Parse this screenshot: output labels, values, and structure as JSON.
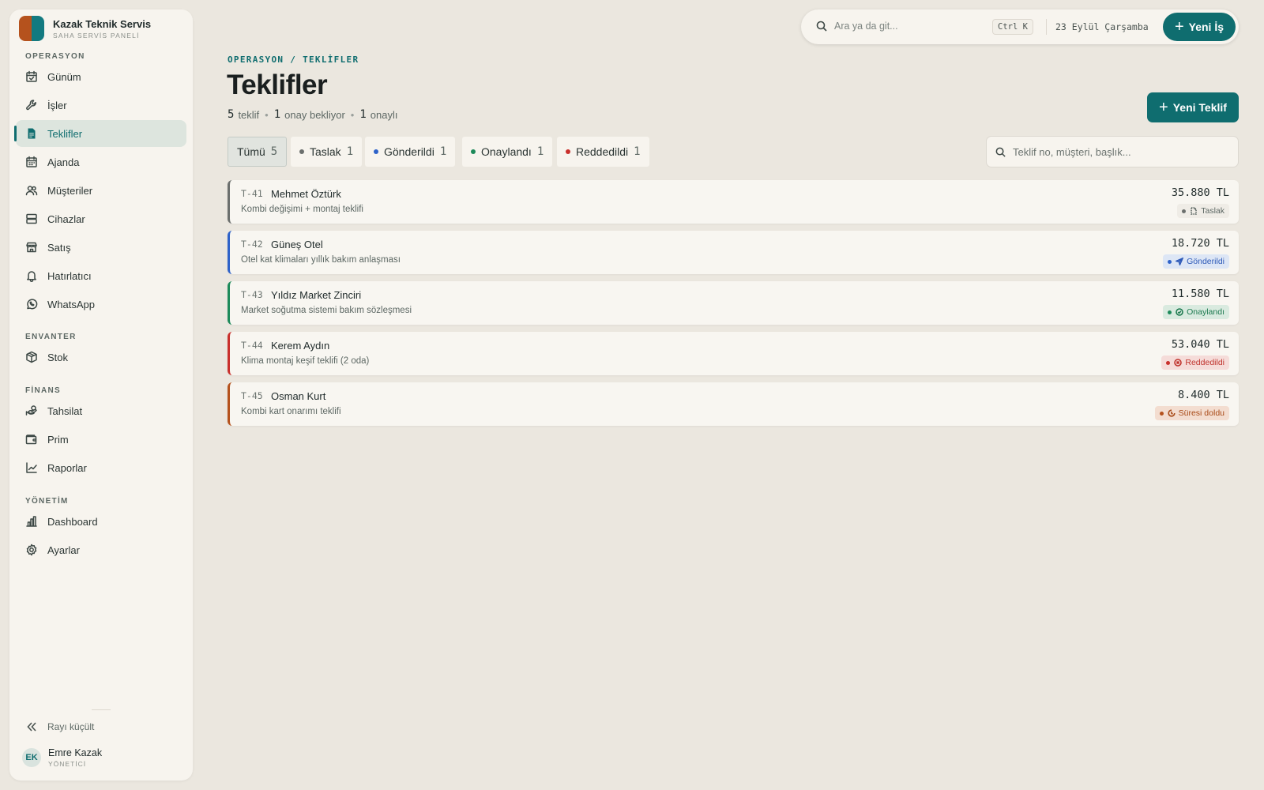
{
  "app": {
    "name": "Kazak Teknik Servis",
    "subtitle": "SAHA SERVİS PANELİ",
    "brand_colors": [
      "#b5521d",
      "#137a80"
    ]
  },
  "sidebar": {
    "sections": [
      {
        "label": "OPERASYON",
        "items": [
          {
            "label": "Günüm",
            "icon": "calendar-check-icon"
          },
          {
            "label": "İşler",
            "icon": "wrench-icon"
          },
          {
            "label": "Teklifler",
            "icon": "document-icon",
            "active": true
          },
          {
            "label": "Ajanda",
            "icon": "calendar-icon"
          },
          {
            "label": "Müşteriler",
            "icon": "users-icon"
          },
          {
            "label": "Cihazlar",
            "icon": "server-icon"
          },
          {
            "label": "Satış",
            "icon": "store-icon"
          },
          {
            "label": "Hatırlatıcı",
            "icon": "bell-icon"
          },
          {
            "label": "WhatsApp",
            "icon": "whatsapp-icon"
          }
        ]
      },
      {
        "label": "ENVANTER",
        "items": [
          {
            "label": "Stok",
            "icon": "box-icon"
          }
        ]
      },
      {
        "label": "FİNANS",
        "items": [
          {
            "label": "Tahsilat",
            "icon": "hand-coins-icon"
          },
          {
            "label": "Prim",
            "icon": "wallet-icon"
          },
          {
            "label": "Raporlar",
            "icon": "chart-line-icon"
          }
        ]
      },
      {
        "label": "YÖNETİM",
        "items": [
          {
            "label": "Dashboard",
            "icon": "bar-chart-icon"
          },
          {
            "label": "Ayarlar",
            "icon": "gear-icon"
          }
        ]
      }
    ],
    "collapse_label": "Rayı küçült",
    "user": {
      "initials": "EK",
      "name": "Emre Kazak",
      "role": "YÖNETİCİ"
    }
  },
  "topbar": {
    "search_placeholder": "Ara ya da git...",
    "shortcut": "Ctrl K",
    "date": "23 Eylül Çarşamba",
    "new_job_label": "Yeni İş"
  },
  "page": {
    "breadcrumb": "OPERASYON / TEKLİFLER",
    "title": "Teklifler",
    "summary": [
      {
        "num": "5",
        "label": "teklif"
      },
      {
        "num": "1",
        "label": "onay bekliyor"
      },
      {
        "num": "1",
        "label": "onaylı"
      }
    ],
    "new_quote_label": "Yeni Teklif",
    "list_search_placeholder": "Teklif no, müşteri, başlık..."
  },
  "filters": [
    {
      "label": "Tümü",
      "count": "5",
      "active": true,
      "dot": null
    },
    {
      "label": "Taslak",
      "count": "1",
      "dot": "#6b6f6d"
    },
    {
      "label": "Gönderildi",
      "count": "1",
      "dot": "#2e62c9"
    },
    {
      "label": "Onaylandı",
      "count": "1",
      "dot": "#1d8a5a"
    },
    {
      "label": "Reddedildi",
      "count": "1",
      "dot": "#c9302c"
    }
  ],
  "quotes": [
    {
      "id": "T-41",
      "customer": "Mehmet Öztürk",
      "title": "Kombi değişimi + montaj teklifi",
      "amount": "35.880 TL",
      "status": "Taslak",
      "status_icon": "draft-file-icon",
      "color": "#6b6f6d",
      "badge_bg": "#efece6",
      "badge_fg": "#5d6864"
    },
    {
      "id": "T-42",
      "customer": "Güneş Otel",
      "title": "Otel kat klimaları yıllık bakım anlaşması",
      "amount": "18.720 TL",
      "status": "Gönderildi",
      "status_icon": "send-icon",
      "color": "#2e62c9",
      "badge_bg": "#dde6f5",
      "badge_fg": "#2e5ab8"
    },
    {
      "id": "T-43",
      "customer": "Yıldız Market Zinciri",
      "title": "Market soğutma sistemi bakım sözleşmesi",
      "amount": "11.580 TL",
      "status": "Onaylandı",
      "status_icon": "check-circle-icon",
      "color": "#1d8a5a",
      "badge_bg": "#d9eadf",
      "badge_fg": "#1d7a4f"
    },
    {
      "id": "T-44",
      "customer": "Kerem Aydın",
      "title": "Klima montaj keşif teklifi (2 oda)",
      "amount": "53.040 TL",
      "status": "Reddedildi",
      "status_icon": "x-circle-icon",
      "color": "#c9302c",
      "badge_bg": "#f5dcd9",
      "badge_fg": "#c0332d"
    },
    {
      "id": "T-45",
      "customer": "Osman Kurt",
      "title": "Kombi kart onarımı teklifi",
      "amount": "8.400 TL",
      "status": "Süresi doldu",
      "status_icon": "clock-icon",
      "color": "#b5521d",
      "badge_bg": "#f3ddd0",
      "badge_fg": "#a84a17"
    }
  ]
}
